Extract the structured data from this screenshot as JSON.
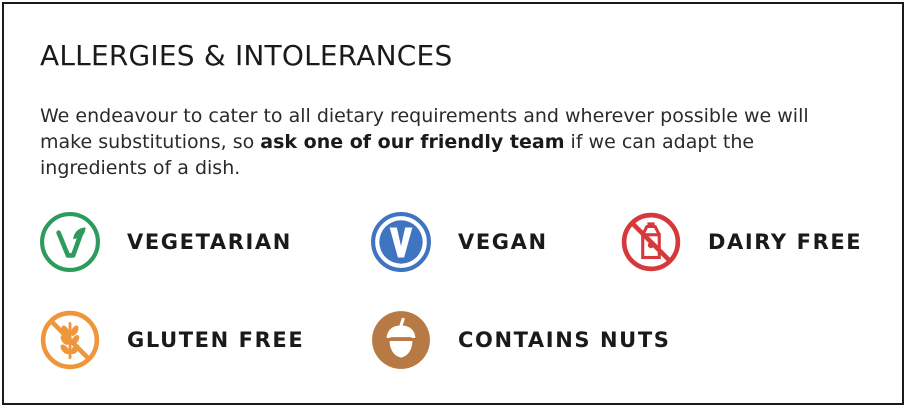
{
  "title": "ALLERGIES & INTOLERANCES",
  "intro": {
    "before": "We endeavour to cater to all dietary requirements and wherever possible we will make substitutions, so ",
    "emphasis": "ask one of our friendly team",
    "after": " if we can adapt the ingredients of a dish."
  },
  "legend": {
    "vegetarian": {
      "label": "VEGETARIAN",
      "icon": "vegetarian-v-icon",
      "color": "#2e9b5e"
    },
    "vegan": {
      "label": "VEGAN",
      "icon": "vegan-v-icon",
      "color": "#3f74c0"
    },
    "dairy_free": {
      "label": "DAIRY FREE",
      "icon": "no-milk-carton-icon",
      "color": "#d6393b"
    },
    "gluten_free": {
      "label": "GLUTEN FREE",
      "icon": "no-wheat-icon",
      "color": "#f0963a"
    },
    "contains_nuts": {
      "label": "CONTAINS NUTS",
      "icon": "acorn-nut-icon",
      "color": "#b87a45"
    }
  }
}
